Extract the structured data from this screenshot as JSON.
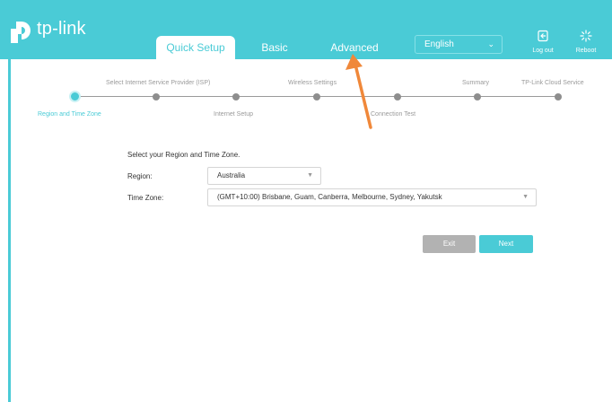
{
  "brand": {
    "name": "tp-link",
    "accent": "#4acbd6"
  },
  "nav": {
    "tabs": [
      {
        "label": "Quick Setup",
        "active": true
      },
      {
        "label": "Basic",
        "active": false
      },
      {
        "label": "Advanced",
        "active": false
      }
    ],
    "language": {
      "selected": "English"
    },
    "logout_label": "Log out",
    "reboot_label": "Reboot"
  },
  "steps": [
    {
      "label": "Region and Time Zone",
      "active": true
    },
    {
      "label": "Select Internet Service Provider (ISP)",
      "active": false
    },
    {
      "label": "Internet Setup",
      "active": false
    },
    {
      "label": "Wireless Settings",
      "active": false
    },
    {
      "label": "Connection Test",
      "active": false
    },
    {
      "label": "Summary",
      "active": false
    },
    {
      "label": "TP-Link Cloud Service",
      "active": false
    }
  ],
  "form": {
    "title": "Select your Region and Time Zone.",
    "region_label": "Region:",
    "region_value": "Australia",
    "timezone_label": "Time Zone:",
    "timezone_value": "(GMT+10:00) Brisbane, Guam, Canberra, Melbourne, Sydney, Yakutsk"
  },
  "buttons": {
    "exit": "Exit",
    "next": "Next"
  },
  "annotation": {
    "type": "arrow",
    "color": "#f0883a",
    "points_to": "Advanced tab"
  }
}
